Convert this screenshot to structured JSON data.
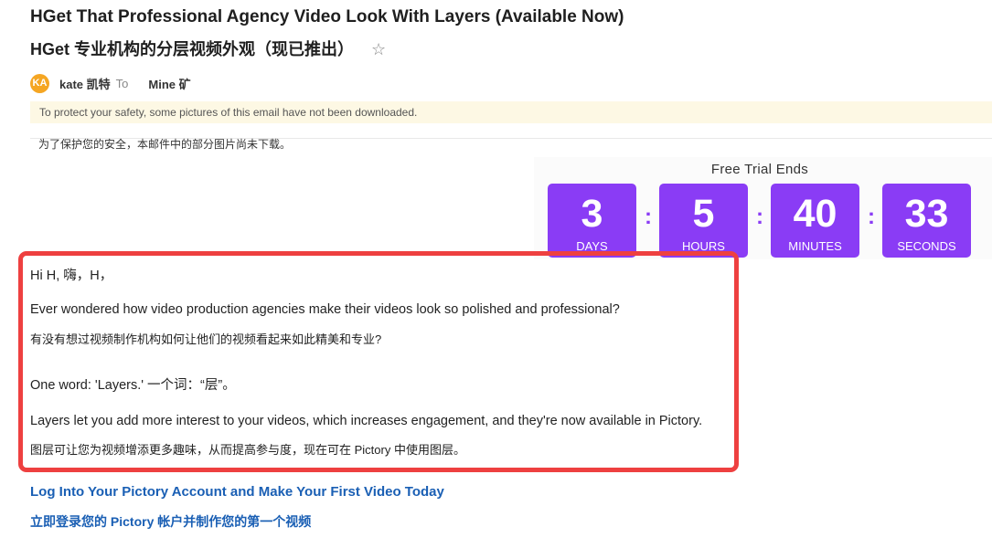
{
  "email": {
    "subject_en": "HGet That Professional Agency Video Look With Layers (Available Now)",
    "subject_cn": "HGet 专业机构的分层视频外观（现已推出）",
    "star_icon": "☆",
    "avatar_initials": "KA",
    "sender": "kate 凯特",
    "to_label": "To",
    "recipient": "Mine 矿",
    "notice_en": "To protect your safety, some pictures of this email have not been downloaded.",
    "notice_cn": "为了保护您的安全，本邮件中的部分图片尚未下载。"
  },
  "countdown": {
    "title": "Free Trial Ends",
    "separator": ":",
    "units": [
      {
        "value": "3",
        "label": "DAYS"
      },
      {
        "value": "5",
        "label": "HOURS"
      },
      {
        "value": "40",
        "label": "MINUTES"
      },
      {
        "value": "33",
        "label": "SECONDS"
      }
    ],
    "accent": "#8a3cf5"
  },
  "body": {
    "greeting": "Hi H, 嗨，H，",
    "para1_en": "Ever wondered how video production agencies make their videos look so polished and professional?",
    "para1_cn": "有没有想过视频制作机构如何让他们的视频看起来如此精美和专业?",
    "para2": "One word: 'Layers.' 一个词：“层”。",
    "para3_en": "Layers let you add more interest to your videos, which increases engagement, and they're now available in Pictory.",
    "para3_cn": "图层可让您为视频增添更多趣味，从而提高参与度，现在可在 Pictory 中使用图层。"
  },
  "cta": {
    "link_en": "Log Into Your Pictory Account and Make Your First Video Today",
    "link_cn": "立即登录您的 Pictory 帐户并制作您的第一个视频",
    "color": "#1a5fb4"
  },
  "highlight_color": "#ee4040"
}
